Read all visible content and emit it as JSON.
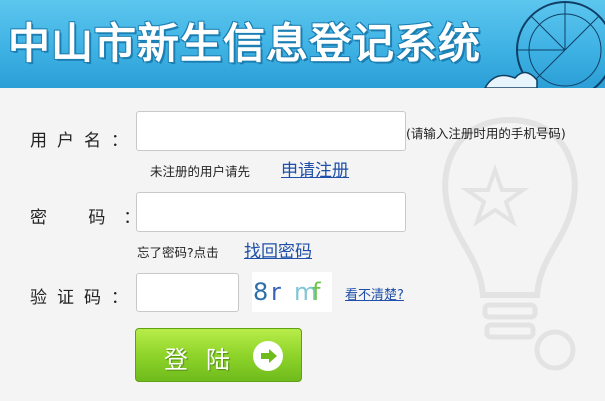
{
  "header": {
    "title": "中山市新生信息登记系统"
  },
  "form": {
    "username": {
      "label": "用户名：",
      "value": "",
      "hint": "(请输入注册时用的手机号码)",
      "register_prompt": "未注册的用户请先",
      "register_link": "申请注册"
    },
    "password": {
      "label": "密 码：",
      "value": "",
      "forgot_prompt": "忘了密码?点击",
      "forgot_link": "找回密码"
    },
    "captcha": {
      "label": "验证码：",
      "value": "",
      "image_chars": [
        "8",
        "r",
        "m",
        "f"
      ],
      "image_colors": [
        "#2f6fa8",
        "#3a63b8",
        "#7fc6d6",
        "#6cc64a"
      ],
      "refresh_link": "看不清楚?"
    },
    "login_button": {
      "label": "登陆",
      "icon": "arrow-right-icon"
    }
  },
  "colors": {
    "banner": "#3fb2e4",
    "button": "#8fd42a",
    "link": "#1f4fa8"
  }
}
